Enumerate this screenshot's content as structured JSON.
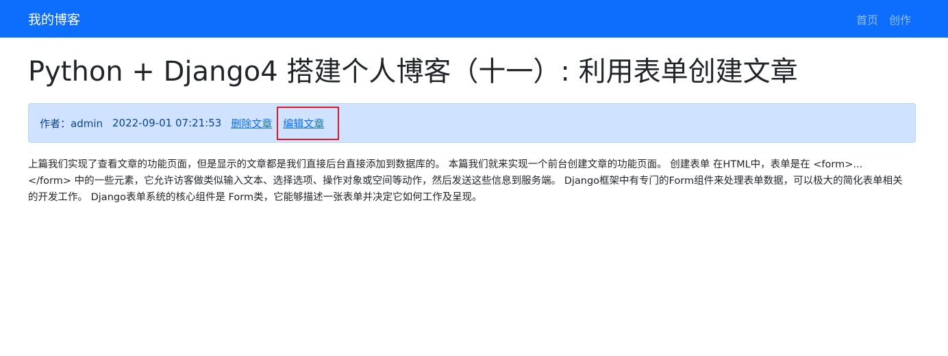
{
  "navbar": {
    "brand": "我的博客",
    "links": [
      "首页",
      "创作"
    ]
  },
  "post": {
    "title": "Python + Django4 搭建个人博客（十一）: 利用表单创建文章",
    "author_line": "作者：admin",
    "time": "2022-09-01 07:21:53",
    "delete_label": "删除文章",
    "edit_label": "编辑文章",
    "body": "上篇我们实现了查看文章的功能页面，但是显示的文章都是我们直接后台直接添加到数据库的。 本篇我们就来实现一个前台创建文章的功能页面。 创建表单 在HTML中，表单是在 <form>...</form> 中的一些元素，它允许访客做类似输入文本、选择选项、操作对象或空间等动作，然后发送这些信息到服务端。 Django框架中有专门的Form组件来处理表单数据，可以极大的简化表单相关的开发工作。 Django表单系统的核心组件是 Form类，它能够描述一张表单并决定它如何工作及呈现。"
  },
  "colors": {
    "navbar_bg": "#0d6efd",
    "alert_bg": "#cfe2ff",
    "highlight_border": "#e0141e"
  }
}
